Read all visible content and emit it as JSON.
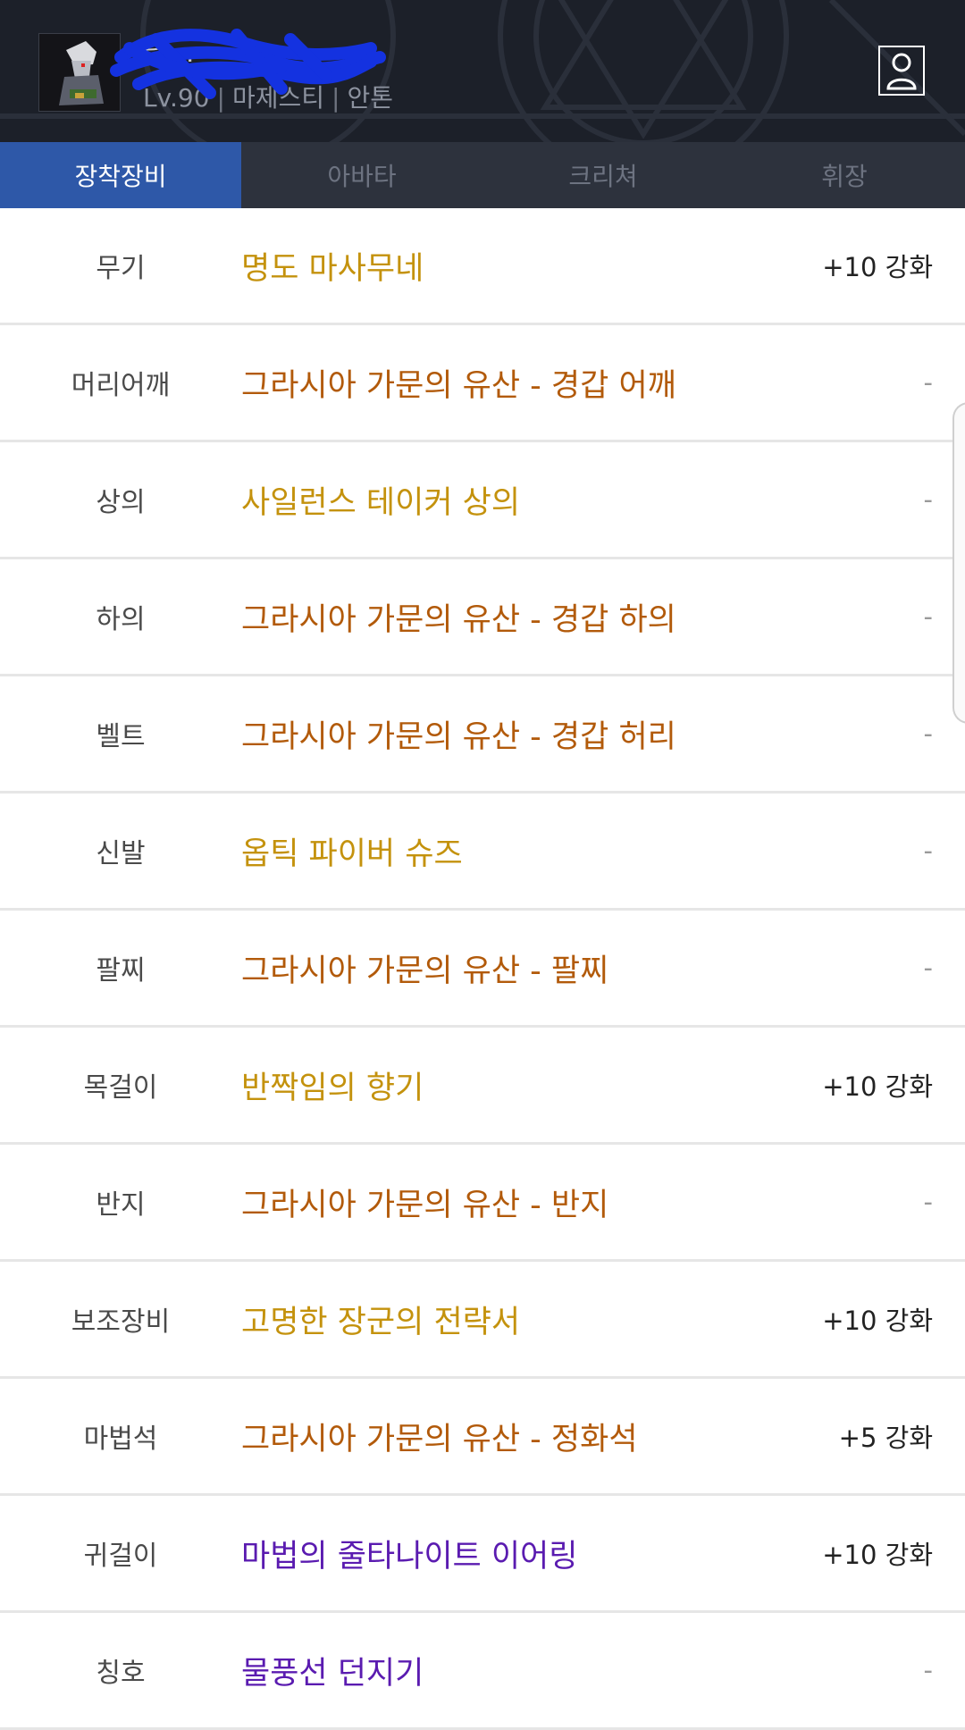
{
  "header": {
    "char_name": "닐…",
    "level": "Lv.90",
    "job": "마제스티",
    "server": "안톤",
    "profile_icon": "person-icon"
  },
  "tabs": [
    {
      "label": "장착장비",
      "active": true
    },
    {
      "label": "아바타",
      "active": false
    },
    {
      "label": "크리쳐",
      "active": false
    },
    {
      "label": "휘장",
      "active": false
    }
  ],
  "colors": {
    "unique": "#c4920d",
    "legacy": "#b25a0a",
    "epic_purple": "#5a1bb0",
    "tab_active": "#2e58a8"
  },
  "equipment": [
    {
      "slot": "무기",
      "item": "명도 마사무네",
      "color": "#c4920d",
      "enhance": "+10 강화"
    },
    {
      "slot": "머리어깨",
      "item": "그라시아 가문의 유산 - 경갑 어깨",
      "color": "#b25a0a",
      "enhance": "-"
    },
    {
      "slot": "상의",
      "item": "사일런스 테이커 상의",
      "color": "#c4920d",
      "enhance": "-"
    },
    {
      "slot": "하의",
      "item": "그라시아 가문의 유산 - 경갑 하의",
      "color": "#b25a0a",
      "enhance": "-"
    },
    {
      "slot": "벨트",
      "item": "그라시아 가문의 유산 - 경갑 허리",
      "color": "#b25a0a",
      "enhance": "-"
    },
    {
      "slot": "신발",
      "item": "옵틱 파이버 슈즈",
      "color": "#c4920d",
      "enhance": "-"
    },
    {
      "slot": "팔찌",
      "item": "그라시아 가문의 유산 - 팔찌",
      "color": "#b25a0a",
      "enhance": "-"
    },
    {
      "slot": "목걸이",
      "item": "반짝임의 향기",
      "color": "#c4920d",
      "enhance": "+10 강화"
    },
    {
      "slot": "반지",
      "item": "그라시아 가문의 유산 - 반지",
      "color": "#b25a0a",
      "enhance": "-"
    },
    {
      "slot": "보조장비",
      "item": "고명한 장군의 전략서",
      "color": "#c4920d",
      "enhance": "+10 강화"
    },
    {
      "slot": "마법석",
      "item": "그라시아 가문의 유산 - 정화석",
      "color": "#b25a0a",
      "enhance": "+5 강화"
    },
    {
      "slot": "귀걸이",
      "item": "마법의 줄타나이트 이어링",
      "color": "#5a1bb0",
      "enhance": "+10 강화"
    },
    {
      "slot": "칭호",
      "item": "물풍선 던지기",
      "color": "#5a1bb0",
      "enhance": "-"
    }
  ]
}
